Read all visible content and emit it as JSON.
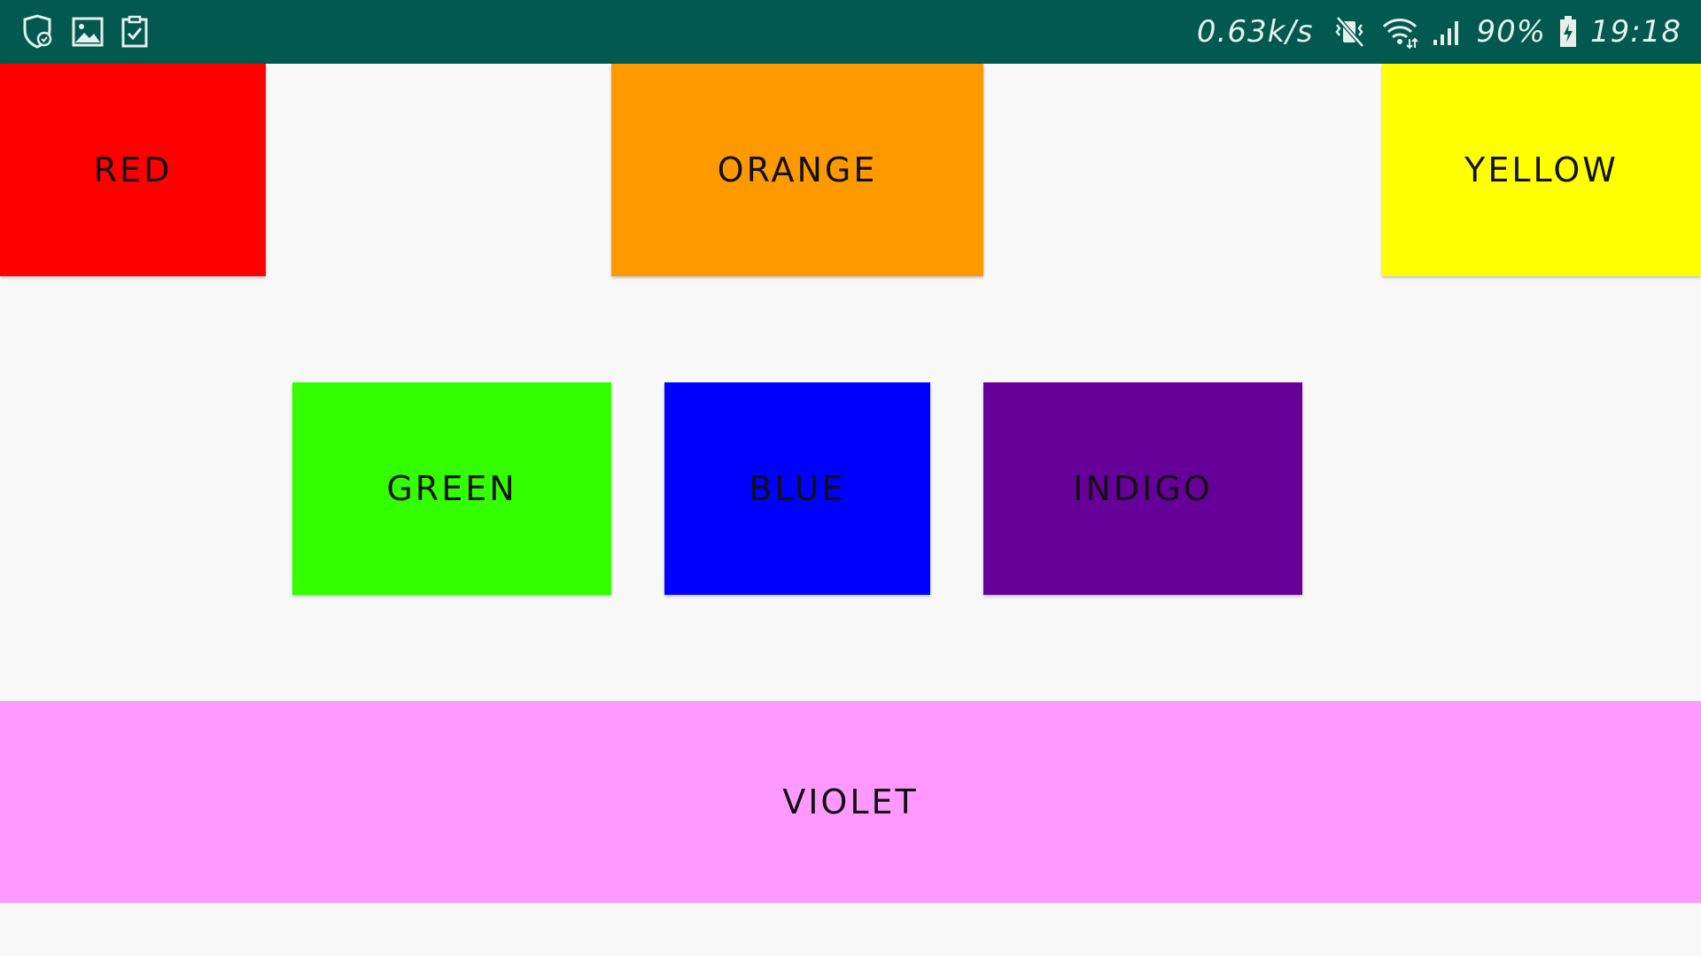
{
  "status_bar": {
    "background": "#01594f",
    "left_icons": [
      "shield-check-icon",
      "image-icon",
      "clipboard-check-icon"
    ],
    "network_speed": "0.63k/s",
    "right_icons": [
      "vibrate-mute-icon",
      "wifi-icon",
      "signal-icon"
    ],
    "battery_percent": "90%",
    "battery_icon": "battery-charging-icon",
    "time": "19:18"
  },
  "boxes": {
    "red": {
      "label": "RED",
      "color": "#ff0000"
    },
    "orange": {
      "label": "ORANGE",
      "color": "#ff9900"
    },
    "yellow": {
      "label": "YELLOW",
      "color": "#ffff00"
    },
    "green": {
      "label": "GREEN",
      "color": "#33ff00"
    },
    "blue": {
      "label": "BLUE",
      "color": "#0000ff"
    },
    "indigo": {
      "label": "INDIGO",
      "color": "#660099"
    },
    "violet": {
      "label": "VIOLET",
      "color": "#ff99ff"
    }
  }
}
